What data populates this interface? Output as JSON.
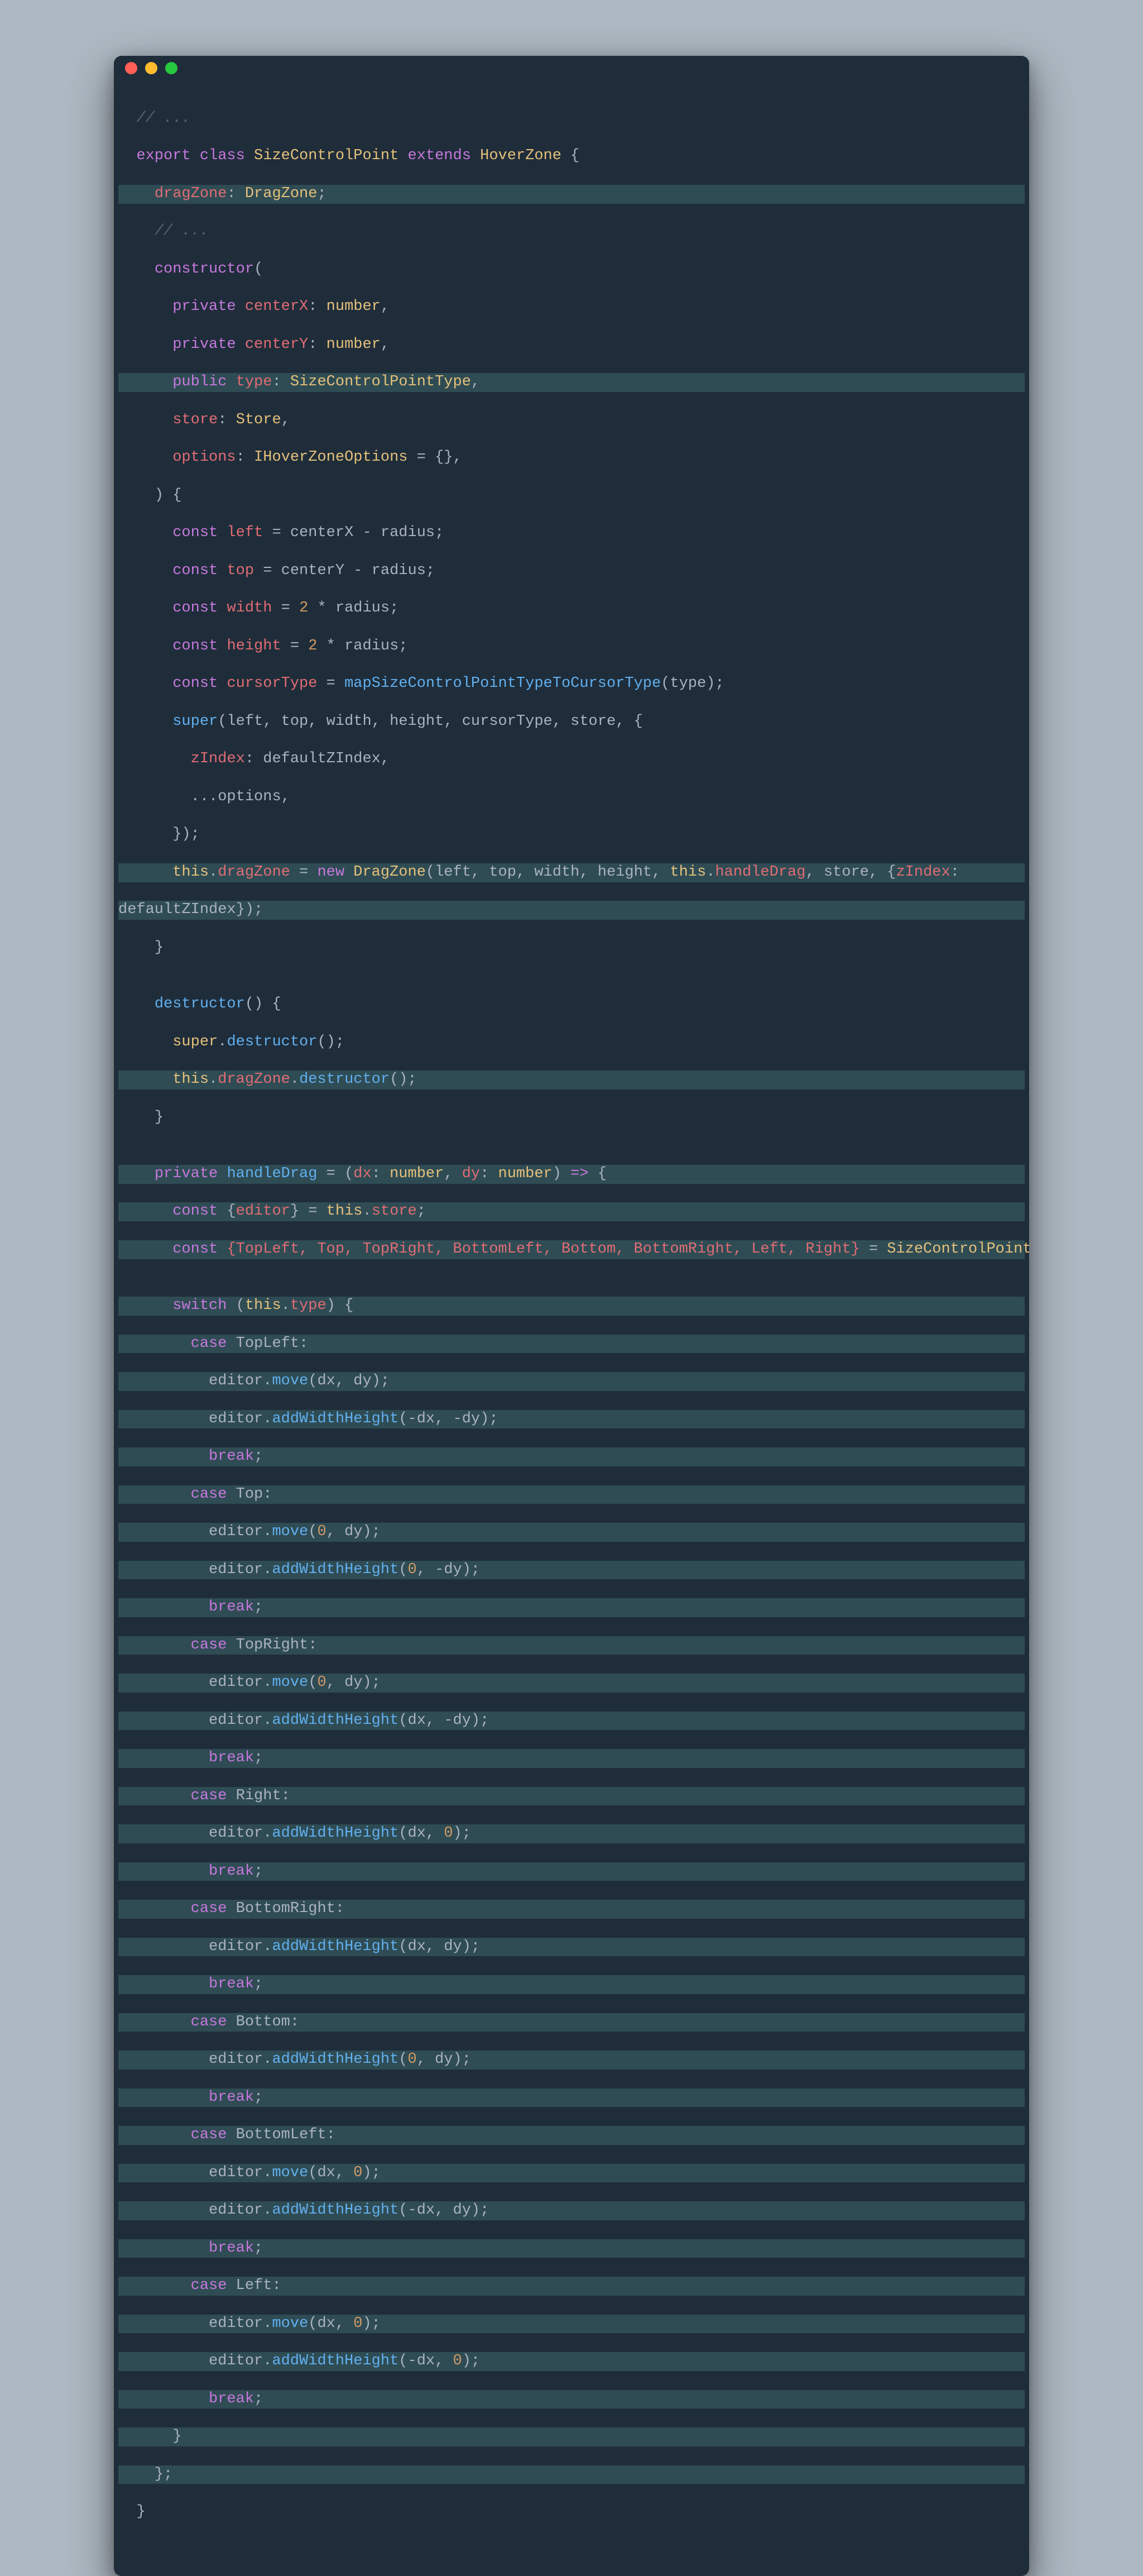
{
  "window": {
    "buttons": [
      "close",
      "minimize",
      "zoom"
    ]
  },
  "code": {
    "comment_ellipsis": "// ...",
    "export": "export",
    "class_kw": "class",
    "class_name": "SizeControlPoint",
    "extends_kw": "extends",
    "super_class": "HoverZone",
    "dragZone_field": "dragZone",
    "dragZone_type": "DragZone",
    "constructor_kw": "constructor",
    "private_kw": "private",
    "public_kw": "public",
    "centerX": "centerX",
    "centerY": "centerY",
    "number_type": "number",
    "type_param": "type",
    "SizeControlPointType": "SizeControlPointType",
    "store_param": "store",
    "Store_type": "Store",
    "options_param": "options",
    "IHoverZoneOptions": "IHoverZoneOptions",
    "default_obj": "{}",
    "const_kw": "const",
    "left_var": "left",
    "top_var": "top",
    "width_var": "width",
    "height_var": "height",
    "cursorType_var": "cursorType",
    "radius": "radius",
    "two": "2",
    "mapFn": "mapSizeControlPointTypeToCursorType",
    "super_call": "super",
    "zIndex_key": "zIndex",
    "defaultZIndex": "defaultZIndex",
    "spread_options": "...options",
    "this_kw": "this",
    "new_kw": "new",
    "DragZone_ctor": "DragZone",
    "handleDrag": "handleDrag",
    "destructor_kw": "destructor",
    "destructor_call": "destructor",
    "handleDrag_name": "handleDrag",
    "dx": "dx",
    "dy": "dy",
    "arrow": "=>",
    "editor": "editor",
    "store_prop": "store",
    "destruct_names": "{TopLeft, Top, TopRight, BottomLeft, Bottom, BottomRight, Left, Right}",
    "switch_kw": "switch",
    "case_kw": "case",
    "break_kw": "break",
    "cases": {
      "TopLeft": "TopLeft",
      "Top": "Top",
      "TopRight": "TopRight",
      "Right": "Right",
      "BottomRight": "BottomRight",
      "Bottom": "Bottom",
      "BottomLeft": "BottomLeft",
      "Left": "Left"
    },
    "move_fn": "move",
    "addWH_fn": "addWidthHeight",
    "zero": "0",
    "minus": "-"
  }
}
